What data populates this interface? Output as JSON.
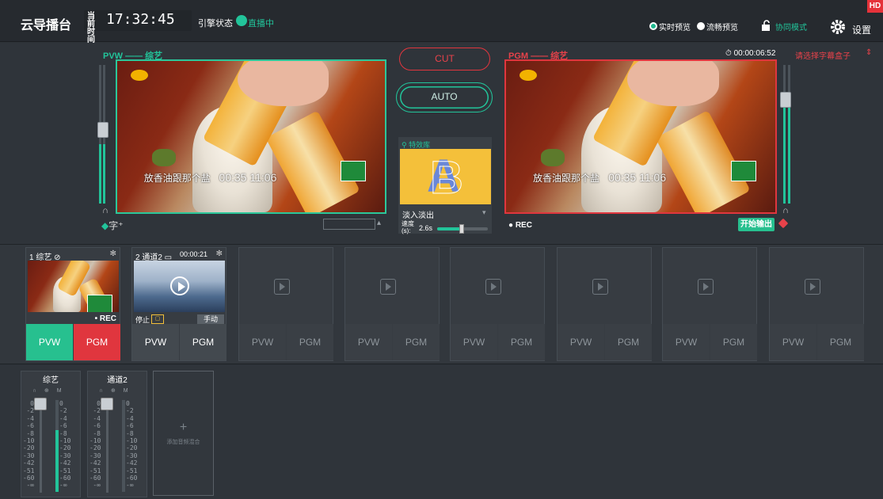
{
  "topbar": {
    "brand": "云导播台",
    "clock_label": "当前时间",
    "clock_time": "17:32:45",
    "stream_label": "引擎状态",
    "stream_status": "直播中",
    "preview_realtime": "实时预览",
    "preview_smooth": "流畅预览",
    "collab": "协同模式",
    "settings": "设置",
    "hd": "HD"
  },
  "pvw": {
    "title": "PVW —— 综艺",
    "subtitle": "放香油跟那个盐",
    "timecode": "00:35 11:06",
    "overlay_icon": "字⁺"
  },
  "pgm": {
    "title": "PGM —— 综艺",
    "timer": "⏱ 00:00:06:52",
    "caption_select": "请选择字幕盒子",
    "subtitle": "放香油跟那个盐",
    "timecode": "00:35 11:06",
    "rec": "● REC",
    "start_output": "开始输出"
  },
  "switcher": {
    "cut": "CUT",
    "auto": "AUTO",
    "effects_title": "特效库",
    "effect_name": "淡入淡出",
    "speed_label": "速度(s):",
    "speed_value": "2.6s"
  },
  "sources": [
    {
      "title": "1 综艺 ⊘",
      "rec": "• REC",
      "pvw": "PVW",
      "pgm": "PGM"
    },
    {
      "title": "2 通道2 ▭",
      "time": "00:00:21",
      "stop": "停止",
      "manual": "手动",
      "pvw": "PVW",
      "pgm": "PGM"
    },
    {
      "pvw": "PVW",
      "pgm": "PGM"
    },
    {
      "pvw": "PVW",
      "pgm": "PGM"
    },
    {
      "pvw": "PVW",
      "pgm": "PGM"
    },
    {
      "pvw": "PVW",
      "pgm": "PGM"
    },
    {
      "pvw": "PVW",
      "pgm": "PGM"
    },
    {
      "pvw": "PVW",
      "pgm": "PGM"
    }
  ],
  "mixer": {
    "strips": [
      {
        "name": "综艺",
        "icons": "∩ ⊕ M"
      },
      {
        "name": "通道2",
        "icons": "∩ ⊕ M"
      }
    ],
    "scale": "0\n-2\n-4\n-6\n-8\n-10\n-20\n-30\n-42\n-51\n-60\n-∞",
    "add_label": "添加音频混合",
    "add_plus": "+"
  },
  "colors": {
    "accent_green": "#22c49a",
    "accent_red": "#e0363e"
  },
  "icons": {
    "lock": "lock-icon",
    "gear": "gear-icon"
  }
}
